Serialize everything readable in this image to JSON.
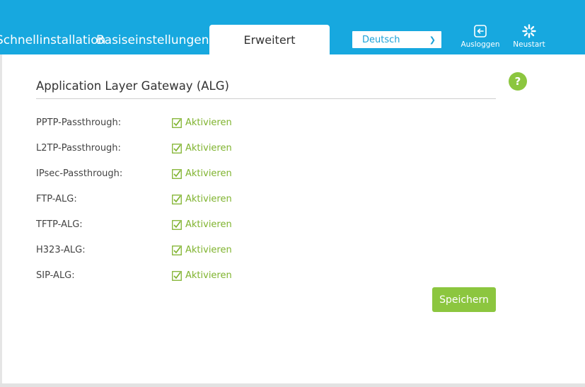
{
  "nav": {
    "tabs": [
      {
        "label": "Schnellinstallation"
      },
      {
        "label": "Basiseinstellungen"
      },
      {
        "label": "Erweitert"
      }
    ]
  },
  "language": {
    "selected": "Deutsch"
  },
  "header_buttons": {
    "logout": "Ausloggen",
    "reboot": "Neustart"
  },
  "section": {
    "title": "Application Layer Gateway (ALG)"
  },
  "rows": [
    {
      "label": "PPTP-Passthrough:",
      "option": "Aktivieren",
      "checked": true
    },
    {
      "label": "L2TP-Passthrough:",
      "option": "Aktivieren",
      "checked": true
    },
    {
      "label": "IPsec-Passthrough:",
      "option": "Aktivieren",
      "checked": true
    },
    {
      "label": "FTP-ALG:",
      "option": "Aktivieren",
      "checked": true
    },
    {
      "label": "TFTP-ALG:",
      "option": "Aktivieren",
      "checked": true
    },
    {
      "label": "H323-ALG:",
      "option": "Aktivieren",
      "checked": true
    },
    {
      "label": "SIP-ALG:",
      "option": "Aktivieren",
      "checked": true
    }
  ],
  "save_label": "Speichern",
  "help_symbol": "?",
  "colors": {
    "header": "#17a8df",
    "accent_green": "#8cc63f",
    "check_text": "#7fb32e"
  }
}
